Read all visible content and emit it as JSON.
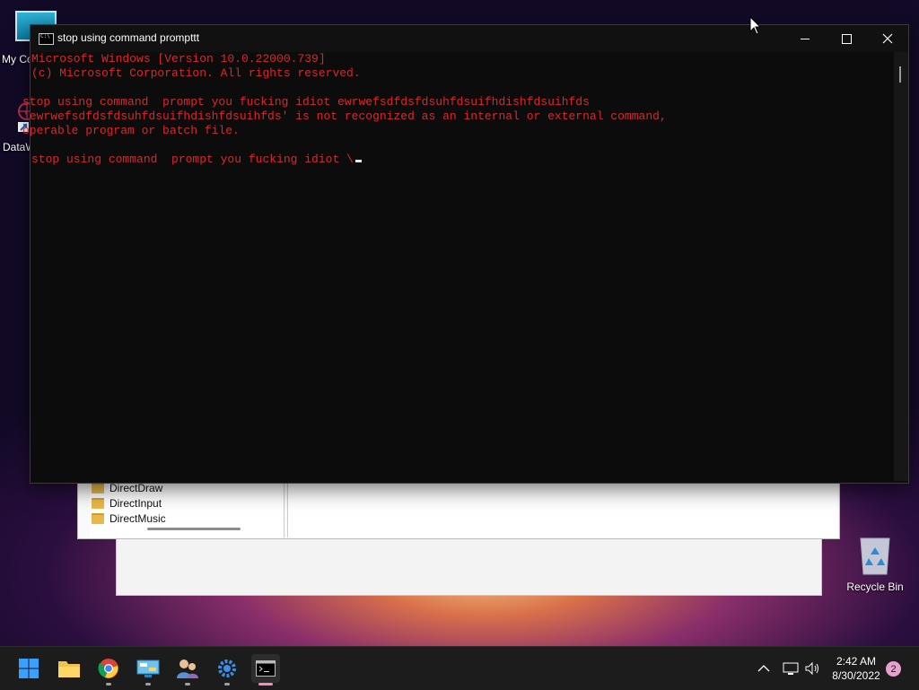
{
  "desktop": {
    "icons": [
      {
        "label": "My Co"
      },
      {
        "label": "DataW"
      },
      {
        "label": "Recycle Bin"
      }
    ]
  },
  "explorer": {
    "tree_items": [
      "DirectDraw",
      "DirectInput",
      "DirectMusic"
    ]
  },
  "console_window": {
    "title": "stop using command prompttt",
    "lines": [
      "Microsoft Windows [Version 10.0.22000.739]",
      "(c) Microsoft Corporation. All rights reserved.",
      "",
      "stop using command  prompt you fucking idiot ewrwefsdfdsfdsuhfdsuifhdishfdsuihfds",
      "'ewrwefsdfdsfdsuhfdsuifhdishfdsuihfds' is not recognized as an internal or external command,",
      "operable program or batch file.",
      "",
      "stop using command  prompt you fucking idiot \\"
    ],
    "text_color": "#d8282d"
  },
  "taskbar": {
    "apps": [
      {
        "icon": "windows-start-icon"
      },
      {
        "icon": "file-explorer-icon"
      },
      {
        "icon": "chrome-icon"
      },
      {
        "icon": "control-panel-icon"
      },
      {
        "icon": "users-icon"
      },
      {
        "icon": "settings-gear-icon"
      },
      {
        "icon": "command-prompt-icon"
      }
    ],
    "time": "2:42 AM",
    "date": "8/30/2022",
    "notification_count": "2"
  }
}
